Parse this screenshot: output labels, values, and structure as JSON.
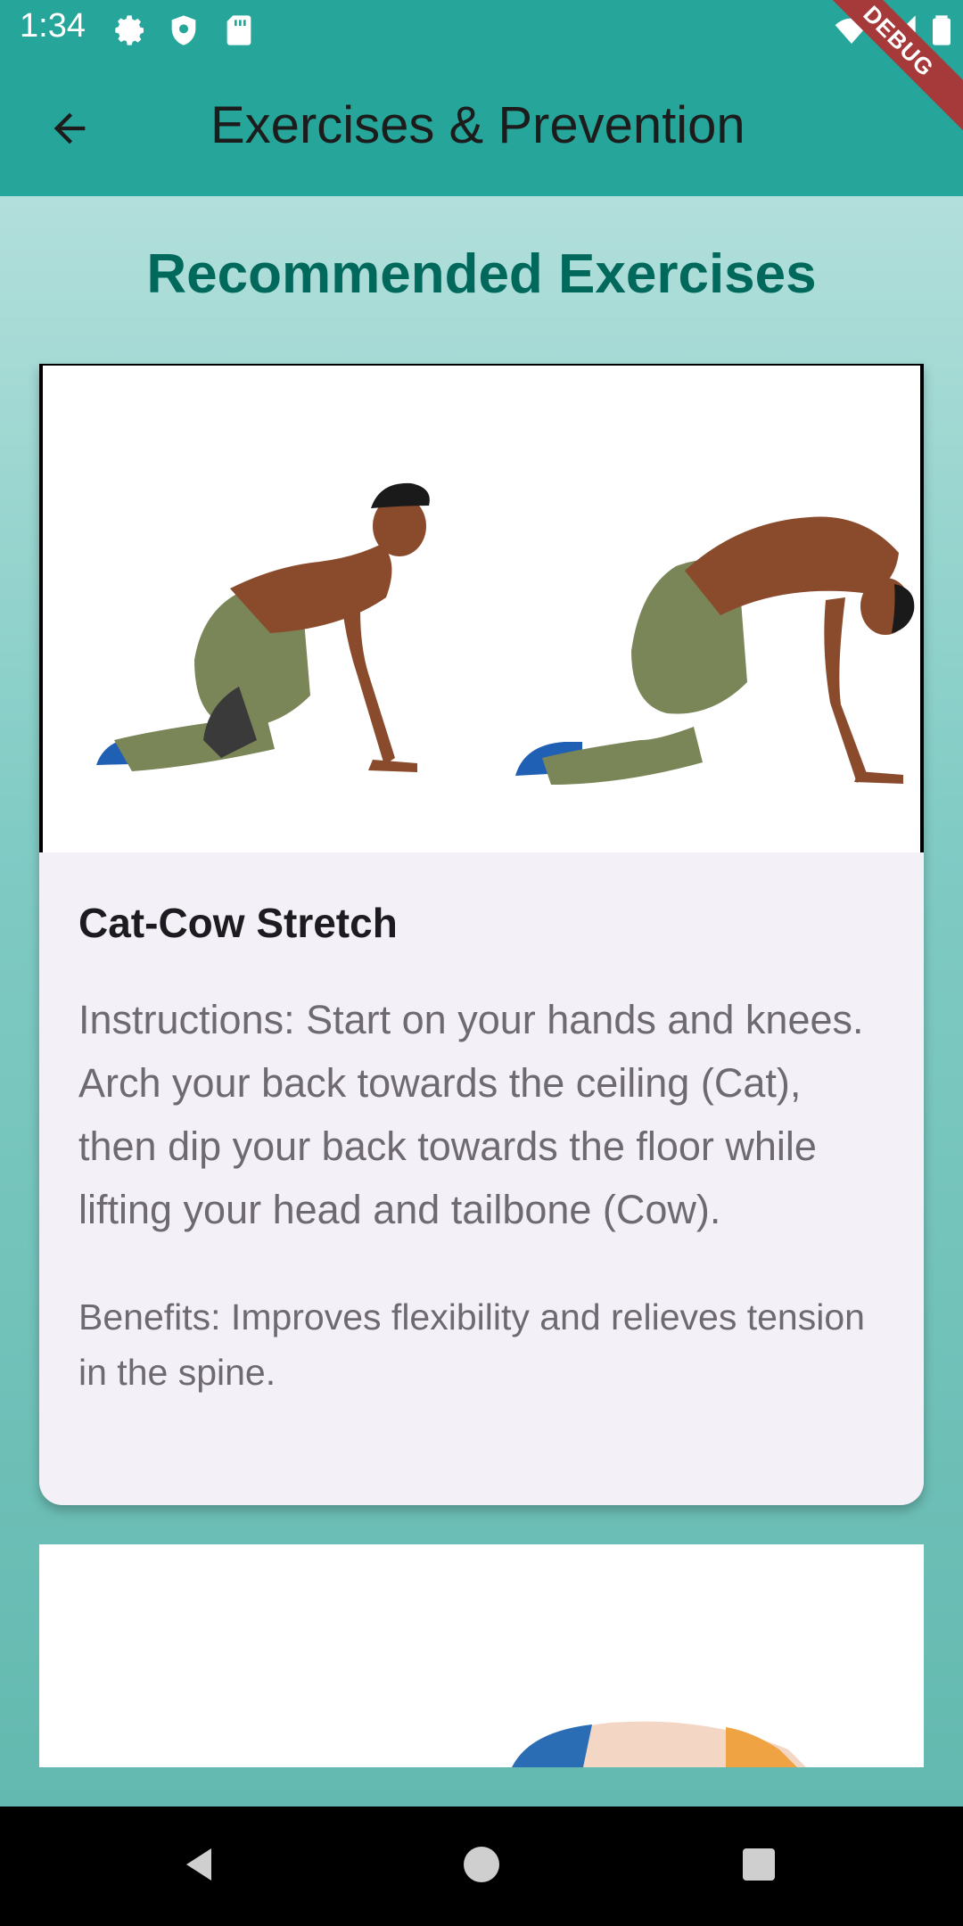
{
  "status_bar": {
    "time": "1:34",
    "icons": [
      "gear-icon",
      "shield-icon",
      "sd-card-icon",
      "wifi-icon",
      "cell-signal-icon",
      "battery-icon"
    ]
  },
  "debug_banner": "DEBUG",
  "app_bar": {
    "title": "Exercises & Prevention",
    "back_icon": "arrow-left-icon"
  },
  "section_title": "Recommended Exercises",
  "exercises": [
    {
      "title": "Cat-Cow Stretch",
      "instructions": "Instructions: Start on your hands and knees. Arch your back towards the ceiling (Cat), then dip your back towards the floor while lifting your head and tailbone (Cow).",
      "benefits": "Benefits: Improves flexibility and relieves tension in the spine."
    }
  ],
  "nav_bar": {
    "back": "back-triangle-icon",
    "home": "home-circle-icon",
    "recents": "recents-square-icon"
  },
  "colors": {
    "app_bar": "#26a69a",
    "section_title": "#00695c",
    "card_bg": "#f4f0f7",
    "body_text": "#6f6a72"
  }
}
